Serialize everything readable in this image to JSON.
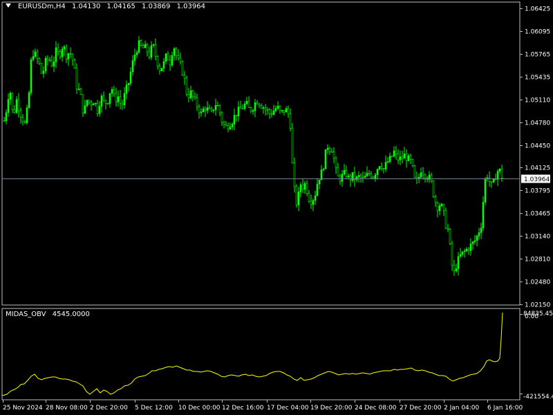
{
  "header": {
    "symbol": "EURUSDm,H4",
    "open": "1.04130",
    "high": "1.04165",
    "low": "1.03869",
    "close": "1.03964"
  },
  "indicator": {
    "name": "MIDAS_OBV",
    "value": "4545.0000",
    "axis_labels": [
      "84835.45",
      "0.00",
      "-421554.45"
    ]
  },
  "colors": {
    "background": "#000000",
    "frame": "#c0c0c0",
    "candle": "#00ff00",
    "indicator_line": "#ffff00",
    "bid_line": "#708090"
  },
  "bid_label": "1.03964",
  "chart_data": {
    "type": "candlestick",
    "symbol": "EURUSDm",
    "timeframe": "H4",
    "ylim": [
      1.0215,
      1.06425
    ],
    "price_ticks": [
      "1.06425",
      "1.06095",
      "1.05765",
      "1.05435",
      "1.05110",
      "1.04780",
      "1.04450",
      "1.04125",
      "1.03795",
      "1.03465",
      "1.03140",
      "1.02810",
      "1.02480",
      "1.02150"
    ],
    "x_labels": [
      "25 Nov 2024",
      "28 Nov 08:00",
      "2 Dec 20:00",
      "5 Dec 12:00",
      "10 Dec 00:00",
      "12 Dec 16:00",
      "17 Dec 04:00",
      "19 Dec 20:00",
      "24 Dec 08:00",
      "27 Dec 20:00",
      "2 Jan 04:00",
      "6 Jan 16:00"
    ],
    "close_path": [
      [
        0,
        1.0505
      ],
      [
        4,
        1.047
      ],
      [
        9,
        1.0495
      ],
      [
        14,
        1.053
      ],
      [
        19,
        1.0485
      ],
      [
        24,
        1.051
      ],
      [
        30,
        1.049
      ],
      [
        36,
        1.0475
      ],
      [
        41,
        1.0505
      ],
      [
        46,
        1.058
      ],
      [
        51,
        1.0575
      ],
      [
        56,
        1.0565
      ],
      [
        61,
        1.0545
      ],
      [
        66,
        1.0565
      ],
      [
        71,
        1.057
      ],
      [
        76,
        1.056
      ],
      [
        81,
        1.058
      ],
      [
        86,
        1.0575
      ],
      [
        91,
        1.059
      ],
      [
        96,
        1.0575
      ],
      [
        101,
        1.058
      ],
      [
        106,
        1.0565
      ],
      [
        111,
        1.053
      ],
      [
        116,
        1.052
      ],
      [
        121,
        1.049
      ],
      [
        126,
        1.051
      ],
      [
        131,
        1.0505
      ],
      [
        136,
        1.051
      ],
      [
        141,
        1.0495
      ],
      [
        146,
        1.0515
      ],
      [
        151,
        1.0505
      ],
      [
        156,
        1.051
      ],
      [
        161,
        1.053
      ],
      [
        166,
        1.051
      ],
      [
        171,
        1.0515
      ],
      [
        176,
        1.05
      ],
      [
        181,
        1.052
      ],
      [
        186,
        1.0535
      ],
      [
        191,
        1.056
      ],
      [
        196,
        1.058
      ],
      [
        201,
        1.059
      ],
      [
        206,
        1.0585
      ],
      [
        211,
        1.0585
      ],
      [
        216,
        1.0575
      ],
      [
        221,
        1.059
      ],
      [
        226,
        1.057
      ],
      [
        231,
        1.0555
      ],
      [
        236,
        1.056
      ],
      [
        241,
        1.0575
      ],
      [
        246,
        1.0565
      ],
      [
        251,
        1.059
      ],
      [
        256,
        1.057
      ],
      [
        261,
        1.056
      ],
      [
        266,
        1.0545
      ],
      [
        271,
        1.0515
      ],
      [
        276,
        1.052
      ],
      [
        281,
        1.051
      ],
      [
        286,
        1.05
      ],
      [
        291,
        1.049
      ],
      [
        296,
        1.05
      ],
      [
        301,
        1.0495
      ],
      [
        306,
        1.049
      ],
      [
        311,
        1.0505
      ],
      [
        316,
        1.05
      ],
      [
        321,
        1.048
      ],
      [
        326,
        1.047
      ],
      [
        331,
        1.0475
      ],
      [
        336,
        1.048
      ],
      [
        341,
        1.049
      ],
      [
        346,
        1.0495
      ],
      [
        351,
        1.05
      ],
      [
        356,
        1.0505
      ],
      [
        361,
        1.0495
      ],
      [
        366,
        1.05
      ],
      [
        371,
        1.051
      ],
      [
        376,
        1.0505
      ],
      [
        381,
        1.05
      ],
      [
        386,
        1.0495
      ],
      [
        391,
        1.049
      ],
      [
        396,
        1.0495
      ],
      [
        401,
        1.05
      ],
      [
        406,
        1.049
      ],
      [
        411,
        1.0495
      ],
      [
        416,
        1.0495
      ],
      [
        421,
        1.047
      ],
      [
        424,
        1.039
      ],
      [
        427,
        1.0375
      ],
      [
        430,
        1.0355
      ],
      [
        434,
        1.039
      ],
      [
        438,
        1.0385
      ],
      [
        442,
        1.039
      ],
      [
        446,
        1.037
      ],
      [
        450,
        1.0365
      ],
      [
        455,
        1.037
      ],
      [
        460,
        1.0395
      ],
      [
        465,
        1.0405
      ],
      [
        469,
        1.042
      ],
      [
        473,
        1.0445
      ],
      [
        477,
        1.044
      ],
      [
        481,
        1.044
      ],
      [
        485,
        1.041
      ],
      [
        490,
        1.0395
      ],
      [
        495,
        1.04
      ],
      [
        500,
        1.0405
      ],
      [
        505,
        1.0395
      ],
      [
        510,
        1.04
      ],
      [
        515,
        1.0395
      ],
      [
        520,
        1.04
      ],
      [
        525,
        1.0395
      ],
      [
        530,
        1.04
      ],
      [
        535,
        1.0405
      ],
      [
        540,
        1.04
      ],
      [
        545,
        1.041
      ],
      [
        550,
        1.042
      ],
      [
        555,
        1.041
      ],
      [
        560,
        1.042
      ],
      [
        565,
        1.0425
      ],
      [
        570,
        1.0435
      ],
      [
        575,
        1.0425
      ],
      [
        580,
        1.0425
      ],
      [
        585,
        1.043
      ],
      [
        590,
        1.0425
      ],
      [
        595,
        1.042
      ],
      [
        598,
        1.0405
      ],
      [
        601,
        1.039
      ],
      [
        605,
        1.0395
      ],
      [
        609,
        1.041
      ],
      [
        613,
        1.0405
      ],
      [
        618,
        1.04
      ],
      [
        623,
        1.0395
      ],
      [
        627,
        1.0375
      ],
      [
        632,
        1.0355
      ],
      [
        637,
        1.036
      ],
      [
        641,
        1.035
      ],
      [
        645,
        1.033
      ],
      [
        649,
        1.032
      ],
      [
        653,
        1.0275
      ],
      [
        657,
        1.026
      ],
      [
        661,
        1.0275
      ],
      [
        666,
        1.0285
      ],
      [
        671,
        1.029
      ],
      [
        676,
        1.0295
      ],
      [
        681,
        1.03
      ],
      [
        686,
        1.0305
      ],
      [
        691,
        1.0315
      ],
      [
        696,
        1.033
      ],
      [
        700,
        1.0375
      ],
      [
        703,
        1.0405
      ],
      [
        706,
        1.04
      ],
      [
        710,
        1.0385
      ],
      [
        714,
        1.039
      ],
      [
        718,
        1.0405
      ],
      [
        722,
        1.041
      ],
      [
        726,
        1.04
      ],
      [
        729,
        1.0396
      ]
    ],
    "indicator_path": [
      [
        3,
        572
      ],
      [
        10,
        570
      ],
      [
        16,
        565
      ],
      [
        21,
        563
      ],
      [
        26,
        560
      ],
      [
        30,
        556
      ],
      [
        35,
        555
      ],
      [
        40,
        550
      ],
      [
        45,
        544
      ],
      [
        50,
        541
      ],
      [
        55,
        547
      ],
      [
        60,
        549
      ],
      [
        65,
        547
      ],
      [
        70,
        546
      ],
      [
        75,
        545
      ],
      [
        80,
        545
      ],
      [
        85,
        547
      ],
      [
        90,
        548
      ],
      [
        95,
        548
      ],
      [
        100,
        549
      ],
      [
        105,
        551
      ],
      [
        110,
        552
      ],
      [
        115,
        555
      ],
      [
        120,
        558
      ],
      [
        125,
        566
      ],
      [
        130,
        570
      ],
      [
        135,
        566
      ],
      [
        140,
        562
      ],
      [
        145,
        568
      ],
      [
        150,
        564
      ],
      [
        155,
        566
      ],
      [
        160,
        570
      ],
      [
        165,
        568
      ],
      [
        170,
        564
      ],
      [
        175,
        562
      ],
      [
        180,
        558
      ],
      [
        185,
        557
      ],
      [
        190,
        554
      ],
      [
        195,
        548
      ],
      [
        200,
        545
      ],
      [
        205,
        544
      ],
      [
        210,
        543
      ],
      [
        215,
        540
      ],
      [
        220,
        536
      ],
      [
        225,
        536
      ],
      [
        230,
        534
      ],
      [
        235,
        533
      ],
      [
        240,
        531
      ],
      [
        245,
        530
      ],
      [
        250,
        531
      ],
      [
        255,
        529
      ],
      [
        260,
        531
      ],
      [
        265,
        533
      ],
      [
        270,
        535
      ],
      [
        275,
        535
      ],
      [
        280,
        537
      ],
      [
        285,
        537
      ],
      [
        290,
        538
      ],
      [
        295,
        537
      ],
      [
        300,
        536
      ],
      [
        305,
        537
      ],
      [
        310,
        539
      ],
      [
        315,
        541
      ],
      [
        320,
        544
      ],
      [
        325,
        545
      ],
      [
        330,
        543
      ],
      [
        335,
        542
      ],
      [
        340,
        543
      ],
      [
        345,
        544
      ],
      [
        350,
        542
      ],
      [
        355,
        541
      ],
      [
        360,
        543
      ],
      [
        365,
        542
      ],
      [
        370,
        544
      ],
      [
        375,
        545
      ],
      [
        380,
        544
      ],
      [
        385,
        543
      ],
      [
        390,
        540
      ],
      [
        395,
        538
      ],
      [
        400,
        537
      ],
      [
        405,
        537
      ],
      [
        410,
        539
      ],
      [
        415,
        542
      ],
      [
        420,
        544
      ],
      [
        425,
        548
      ],
      [
        430,
        550
      ],
      [
        435,
        546
      ],
      [
        440,
        550
      ],
      [
        445,
        549
      ],
      [
        450,
        548
      ],
      [
        455,
        546
      ],
      [
        460,
        543
      ],
      [
        465,
        541
      ],
      [
        470,
        539
      ],
      [
        475,
        537
      ],
      [
        480,
        538
      ],
      [
        485,
        540
      ],
      [
        490,
        542
      ],
      [
        495,
        541
      ],
      [
        500,
        540
      ],
      [
        505,
        541
      ],
      [
        510,
        540
      ],
      [
        515,
        541
      ],
      [
        520,
        540
      ],
      [
        525,
        539
      ],
      [
        530,
        540
      ],
      [
        535,
        541
      ],
      [
        540,
        539
      ],
      [
        545,
        538
      ],
      [
        550,
        537
      ],
      [
        555,
        536
      ],
      [
        560,
        536
      ],
      [
        565,
        536
      ],
      [
        570,
        534
      ],
      [
        575,
        535
      ],
      [
        580,
        534
      ],
      [
        585,
        534
      ],
      [
        590,
        533
      ],
      [
        595,
        532
      ],
      [
        600,
        535
      ],
      [
        605,
        536
      ],
      [
        610,
        535
      ],
      [
        615,
        536
      ],
      [
        620,
        538
      ],
      [
        625,
        539
      ],
      [
        630,
        541
      ],
      [
        635,
        543
      ],
      [
        640,
        543
      ],
      [
        645,
        544
      ],
      [
        650,
        548
      ],
      [
        655,
        551
      ],
      [
        660,
        549
      ],
      [
        665,
        547
      ],
      [
        670,
        546
      ],
      [
        675,
        544
      ],
      [
        680,
        542
      ],
      [
        685,
        541
      ],
      [
        690,
        540
      ],
      [
        695,
        536
      ],
      [
        700,
        530
      ],
      [
        704,
        522
      ],
      [
        708,
        520
      ],
      [
        712,
        522
      ],
      [
        716,
        523
      ],
      [
        720,
        522
      ],
      [
        723,
        518
      ],
      [
        725,
        490
      ],
      [
        727,
        452
      ]
    ]
  }
}
